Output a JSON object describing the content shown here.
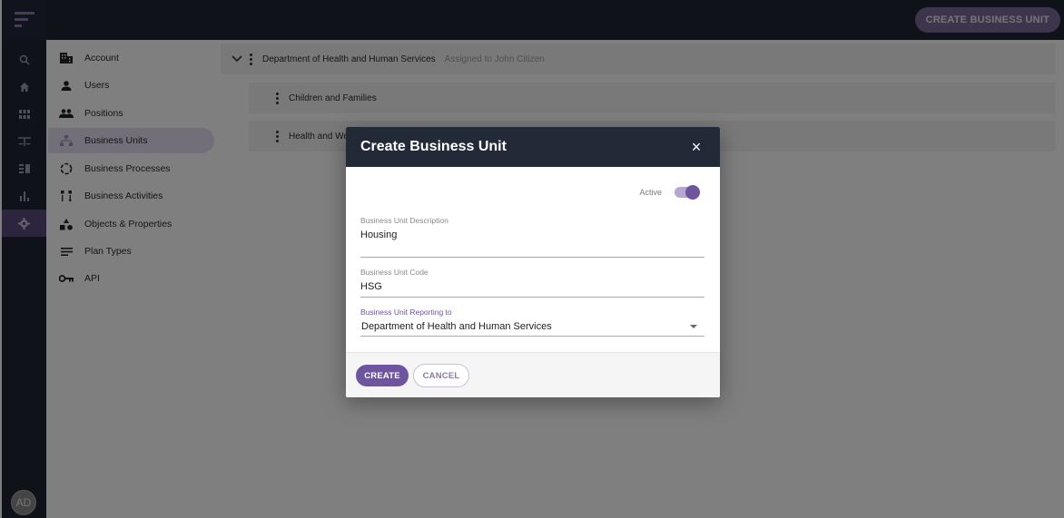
{
  "topbar": {
    "create_button": "CREATE BUSINESS UNIT"
  },
  "rail": {
    "items": [
      "search-icon",
      "home-icon",
      "grid-icon",
      "scales-icon",
      "list-icon",
      "bar-chart-icon",
      "settings-icon"
    ],
    "active_index": 6,
    "avatar": "AD"
  },
  "sidebar": {
    "items": [
      {
        "label": "Account",
        "icon": "building-icon"
      },
      {
        "label": "Users",
        "icon": "user-icon"
      },
      {
        "label": "Positions",
        "icon": "people-icon"
      },
      {
        "label": "Business Units",
        "icon": "hierarchy-icon"
      },
      {
        "label": "Business Processes",
        "icon": "cycle-icon"
      },
      {
        "label": "Business Activities",
        "icon": "activities-icon"
      },
      {
        "label": "Objects & Properties",
        "icon": "shapes-icon"
      },
      {
        "label": "Plan Types",
        "icon": "lines-icon"
      },
      {
        "label": "API",
        "icon": "key-icon"
      }
    ],
    "active_index": 3
  },
  "tree": {
    "root": {
      "name": "Department of Health and Human Services",
      "assigned": "Assigned to John Citizen"
    },
    "children": [
      {
        "name": "Children and Families"
      },
      {
        "name": "Health and We"
      }
    ]
  },
  "modal": {
    "title": "Create Business Unit",
    "close": "×",
    "active_label": "Active",
    "active": true,
    "fields": {
      "description": {
        "label": "Business Unit Description",
        "value": "Housing"
      },
      "code": {
        "label": "Business Unit Code",
        "value": "HSG"
      },
      "reporting": {
        "label": "Business Unit Reporting to",
        "value": "Department of Health and Human Services"
      }
    },
    "create_label": "CREATE",
    "cancel_label": "CANCEL"
  },
  "colors": {
    "accent": "#6f55a0",
    "dark": "#1f2530"
  }
}
